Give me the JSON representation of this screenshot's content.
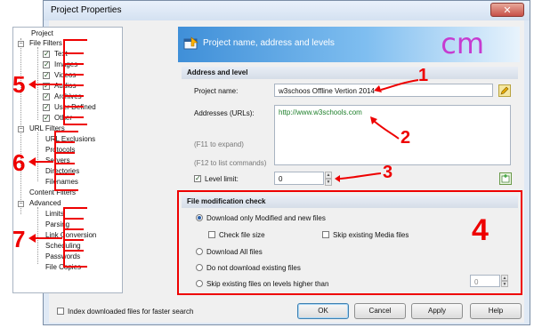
{
  "window": {
    "title": "Project Properties",
    "close_label": "✕"
  },
  "tree": {
    "root": "Project",
    "file_filters": {
      "label": "File Filters",
      "items": [
        "Text",
        "Images",
        "Videos",
        "Audios",
        "Archives",
        "User Defined",
        "Other"
      ]
    },
    "url_filters": {
      "label": "URL Filters",
      "items": [
        "URL Exclusions",
        "Protocols",
        "Servers",
        "Directories",
        "Filenames"
      ]
    },
    "content_filters": "Content Filters",
    "advanced": {
      "label": "Advanced",
      "items": [
        "Limits",
        "Parsing",
        "Link Conversion",
        "Scheduling",
        "Passwords",
        "File Copies"
      ]
    }
  },
  "header": {
    "title": "Project name, address and levels",
    "logo": "cm"
  },
  "address_section": {
    "title": "Address and level",
    "project_name_label": "Project name:",
    "project_name_value": "w3schoos Offline Vertion 2014",
    "addresses_label": "Addresses (URLs):",
    "addresses_value": "http://www.w3schools.com",
    "hint1": "(F11 to expand)",
    "hint2": "(F12 to list commands)",
    "level_limit_label": "Level limit:",
    "level_limit_value": "0"
  },
  "file_mod": {
    "title": "File modification check",
    "opt1": "Download only Modified and new files",
    "check_file_size": "Check file size",
    "skip_media": "Skip existing Media files",
    "opt2": "Download All files",
    "opt3": "Do not download existing files",
    "opt4": "Skip existing files on levels higher than",
    "opt4_value": "0"
  },
  "footer": {
    "index_label": "Index downloaded files for faster search",
    "ok": "OK",
    "cancel": "Cancel",
    "apply": "Apply",
    "help": "Help"
  },
  "annotations": {
    "n1": "1",
    "n2": "2",
    "n3": "3",
    "n4": "4",
    "n5": "5",
    "n6": "6",
    "n7": "7"
  },
  "colors": {
    "annotation": "#e00000",
    "header_blue": "#3f8fd8",
    "logo": "#c63bd0"
  }
}
